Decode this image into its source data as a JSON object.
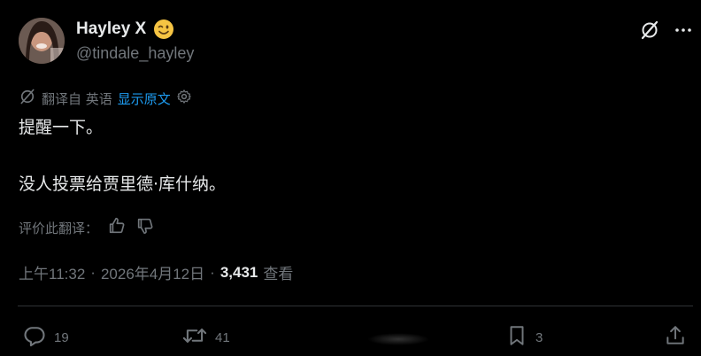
{
  "author": {
    "display_name": "Hayley X",
    "handle": "@tindale_hayley",
    "emoji_icon": "winking-face-emoji"
  },
  "translation": {
    "translated_from": "翻译自 英语",
    "show_original_label": "显示原文"
  },
  "tweet": {
    "line1": "提醒一下。",
    "line2": "没人投票给贾里德·库什纳。"
  },
  "rate_translation_label": "评价此翻译：",
  "meta": {
    "time": "上午11:32",
    "separator1": "·",
    "date": "2026年4月12日",
    "separator2": "·",
    "views_count": "3,431",
    "views_label": "查看"
  },
  "actions": {
    "replies": "19",
    "reposts": "41",
    "likes": "",
    "bookmarks": "3"
  },
  "colors": {
    "background": "#000000",
    "text_primary": "#e7e9ea",
    "text_secondary": "#71767b",
    "link": "#1d9bf0",
    "divider": "#2f3336"
  }
}
